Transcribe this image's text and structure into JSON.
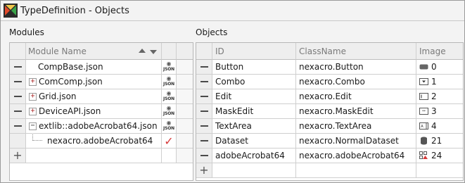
{
  "window": {
    "title": "TypeDefinition - Objects"
  },
  "modules": {
    "panel_label": "Modules",
    "column_header": "Module Name",
    "rows": [
      {
        "name": "CompBase.json",
        "expander": "",
        "badge": "JSON"
      },
      {
        "name": "ComComp.json",
        "expander": "+",
        "badge": "JSON"
      },
      {
        "name": "Grid.json",
        "expander": "+",
        "badge": "JSON"
      },
      {
        "name": "DeviceAPI.json",
        "expander": "+",
        "badge": "JSON"
      },
      {
        "name": "extlib::adobeAcrobat64.json",
        "expander": "−",
        "badge": "JSON"
      },
      {
        "name": "nexacro.adobeAcrobat64",
        "expander": "",
        "badge": "✓"
      }
    ],
    "add_label": "+"
  },
  "objects": {
    "panel_label": "Objects",
    "columns": {
      "id": "ID",
      "classname": "ClassName",
      "image": "Image"
    },
    "rows": [
      {
        "id": "Button",
        "classname": "nexacro.Button",
        "image": "0",
        "icon": "button-icon"
      },
      {
        "id": "Combo",
        "classname": "nexacro.Combo",
        "image": "1",
        "icon": "combo-icon"
      },
      {
        "id": "Edit",
        "classname": "nexacro.Edit",
        "image": "2",
        "icon": "edit-icon"
      },
      {
        "id": "MaskEdit",
        "classname": "nexacro.MaskEdit",
        "image": "3",
        "icon": "maskedit-icon"
      },
      {
        "id": "TextArea",
        "classname": "nexacro.TextArea",
        "image": "4",
        "icon": "textarea-icon"
      },
      {
        "id": "Dataset",
        "classname": "nexacro.NormalDataset",
        "image": "21",
        "icon": "dataset-icon"
      },
      {
        "id": "adobeAcrobat64",
        "classname": "nexacro.adobeAcrobat64",
        "image": "24",
        "icon": "component-icon"
      }
    ],
    "add_label": "+"
  },
  "colors": {
    "check": "#d63a3a",
    "header_bg": "#eeeeee",
    "grid_line": "#cfcfcf"
  }
}
